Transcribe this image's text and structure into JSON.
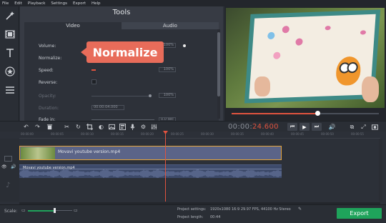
{
  "menu": [
    "File",
    "Edit",
    "Playback",
    "Settings",
    "Export",
    "Help"
  ],
  "left_tools": [
    "magic-wand",
    "film",
    "text",
    "star",
    "list"
  ],
  "tools_panel": {
    "title": "Tools",
    "tabs": [
      "Video",
      "Audio"
    ],
    "rows": {
      "volume": {
        "label": "Volume:",
        "value": "100%",
        "level": 0.9
      },
      "normalize": {
        "label": "Normalize:",
        "checked": true
      },
      "speed": {
        "label": "Speed:",
        "value": "100%"
      },
      "reverse": {
        "label": "Reverse:"
      },
      "opacity": {
        "label": "Opacity:",
        "value": "100%"
      },
      "duration": {
        "label": "Duration:",
        "value": "00:00:04.000"
      },
      "fade_in": {
        "label": "Fade in:",
        "value": "0.0 sec"
      }
    }
  },
  "callout": {
    "text": "Normalize"
  },
  "preview": {
    "progress": 0.58
  },
  "toolbar": {
    "timecode_prefix": "00:00:",
    "timecode_value": "24.600"
  },
  "ruler": [
    "00:00:00",
    "00:00:05",
    "00:00:10",
    "00:00:15",
    "00:00:20",
    "00:00:25",
    "00:00:30",
    "00:00:35",
    "00:00:40",
    "00:00:45",
    "00:00:50",
    "00:00:55"
  ],
  "timeline": {
    "video_clip": "Movavi youtube version.mp4",
    "audio_clip": "Movavi youtube version.mp4"
  },
  "bottom": {
    "scale_label": "Scale:",
    "project_settings_label": "Project settings:",
    "project_settings_value": "1920x1080 16:9 29.97 FPS, 44100 Hz Stereo",
    "project_length_label": "Project length:",
    "project_length_value": "00:44",
    "export_label": "Export"
  },
  "colors": {
    "accent": "#e0533f",
    "callout": "#e86c5a",
    "export": "#1fa35b"
  }
}
